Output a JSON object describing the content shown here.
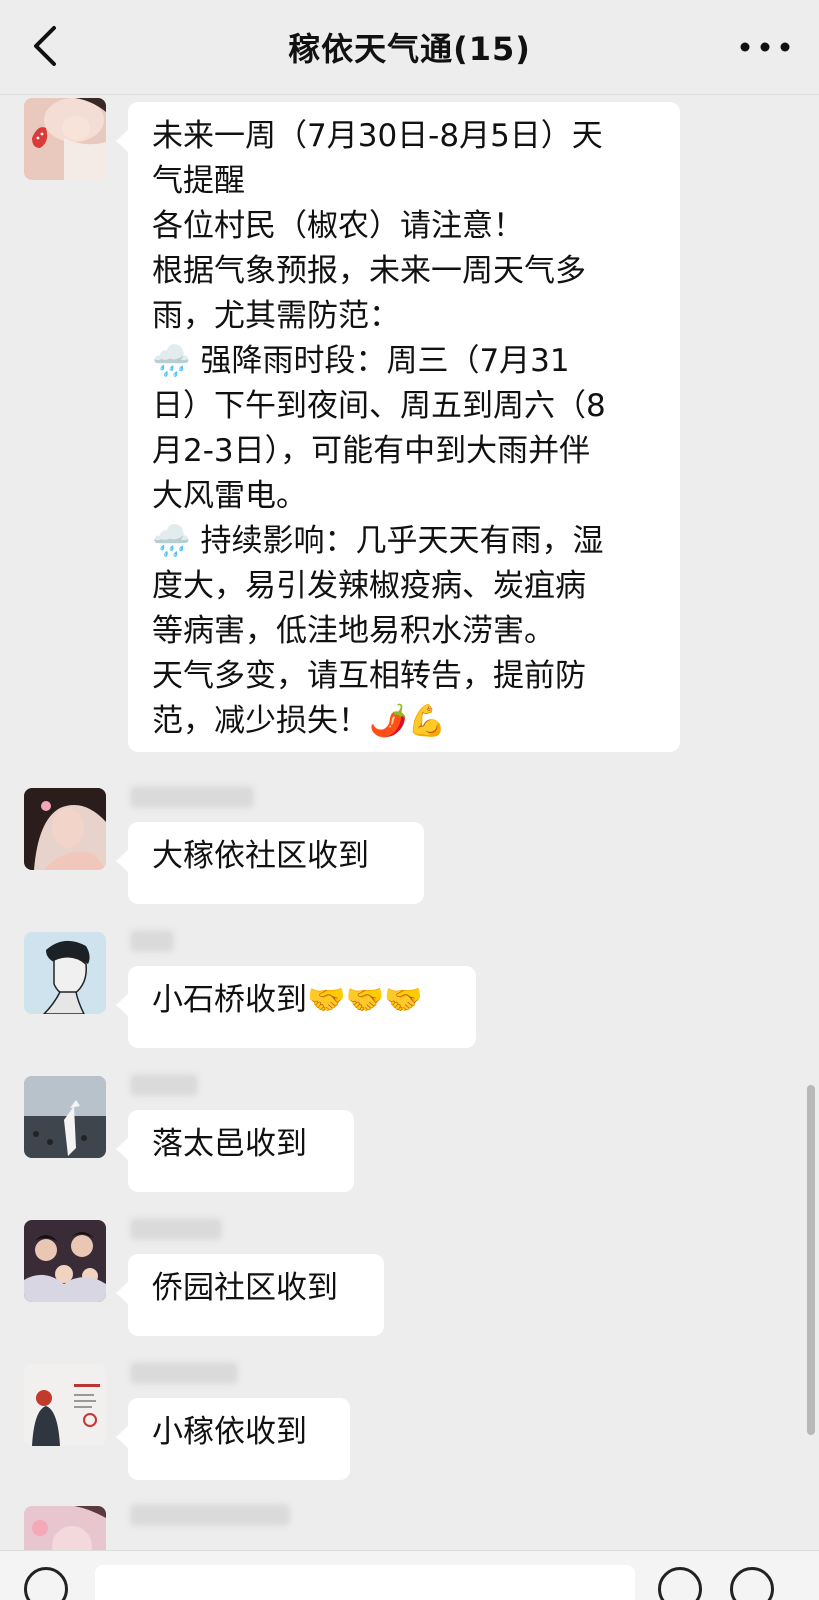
{
  "header": {
    "title": "稼依天气通(15)",
    "back_icon": "chevron-left-icon",
    "more_icon": "more-dots-icon"
  },
  "messages": [
    {
      "lines": [
        "未来一周（7月30日-8月5日）天",
        "气提醒",
        "各位村民（椒农）请注意！",
        "根据气象预报，未来一周天气多",
        "雨，尤其需防范：",
        "🌧️ 强降雨时段：周三（7月31",
        "日）下午到夜间、周五到周六（8",
        "月2-3日），可能有中到大雨并伴",
        "大风雷电。",
        "🌧️ 持续影响：几乎天天有雨，湿",
        "度大，易引发辣椒疫病、炭疽病",
        "等病害，低洼地易积水涝害。",
        "天气多变，请互相转告，提前防",
        "范，减少损失！🌶️💪"
      ]
    },
    {
      "text": "大稼依社区收到"
    },
    {
      "text": "小石桥收到🤝🤝🤝"
    },
    {
      "text": "落太邑收到"
    },
    {
      "text": "侨园社区收到"
    },
    {
      "text": "小稼依收到"
    }
  ],
  "colors": {
    "background": "#ededed",
    "bubble": "#ffffff",
    "text": "#111111"
  }
}
